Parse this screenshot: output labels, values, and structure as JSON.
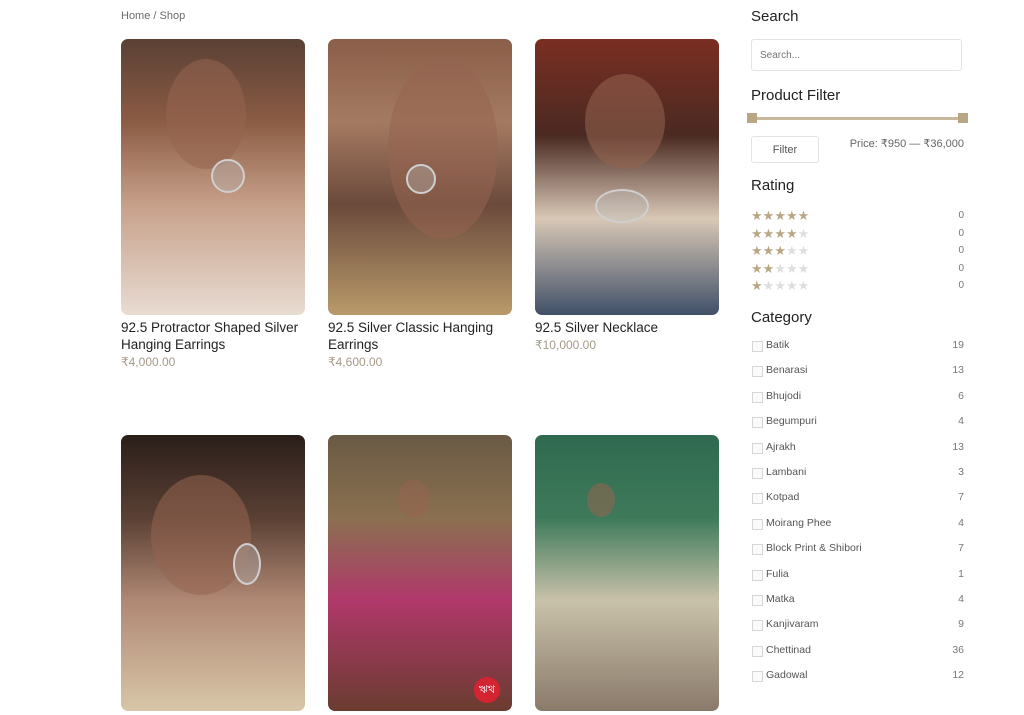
{
  "breadcrumb": {
    "home": "Home",
    "separator": " / ",
    "current": "Shop"
  },
  "products": [
    {
      "title": "92.5 Protractor Shaped Silver Hanging Earrings",
      "price": "₹4,000.00"
    },
    {
      "title": "92.5 Silver Classic Hanging Earrings",
      "price": "₹4,600.00"
    },
    {
      "title": "92.5 Silver Necklace",
      "price": "₹10,000.00"
    },
    {
      "title": "",
      "price": ""
    },
    {
      "title": "",
      "price": "",
      "badge": "ঋথ"
    },
    {
      "title": "",
      "price": ""
    }
  ],
  "sidebar": {
    "search": {
      "heading": "Search",
      "placeholder": "Search..."
    },
    "product_filter": {
      "heading": "Product Filter",
      "button_label": "Filter",
      "price_label": "Price: ₹950 — ₹36,000"
    },
    "rating": {
      "heading": "Rating",
      "rows": [
        {
          "stars": 5,
          "count": "0"
        },
        {
          "stars": 4,
          "count": "0"
        },
        {
          "stars": 3,
          "count": "0"
        },
        {
          "stars": 2,
          "count": "0"
        },
        {
          "stars": 1,
          "count": "0"
        }
      ]
    },
    "category": {
      "heading": "Category",
      "items": [
        {
          "label": "Batik",
          "count": "19"
        },
        {
          "label": "Benarasi",
          "count": "13"
        },
        {
          "label": "Bhujodi",
          "count": "6"
        },
        {
          "label": "Begumpuri",
          "count": "4"
        },
        {
          "label": "Ajrakh",
          "count": "13"
        },
        {
          "label": "Lambani",
          "count": "3"
        },
        {
          "label": "Kotpad",
          "count": "7"
        },
        {
          "label": "Moirang Phee",
          "count": "4"
        },
        {
          "label": "Block Print & Shibori",
          "count": "7"
        },
        {
          "label": "Fulia",
          "count": "1"
        },
        {
          "label": "Matka",
          "count": "4"
        },
        {
          "label": "Kanjivaram",
          "count": "9"
        },
        {
          "label": "Chettinad",
          "count": "36"
        },
        {
          "label": "Gadowal",
          "count": "12"
        }
      ]
    }
  },
  "colors": {
    "accent": "#b9a685",
    "price": "#a59a86",
    "badge": "#d42432"
  }
}
